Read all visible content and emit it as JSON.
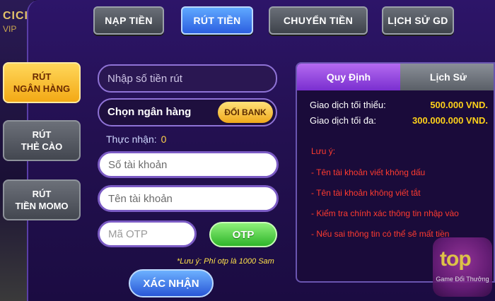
{
  "background": {
    "brand_text": "CICI",
    "brand_sub": "VIP"
  },
  "top_tabs": [
    {
      "label": "NẠP TIỀN",
      "active": false
    },
    {
      "label": "RÚT TIỀN",
      "active": true
    },
    {
      "label": "CHUYỂN TIỀN",
      "active": false
    },
    {
      "label": "LỊCH SỬ GD",
      "active": false
    }
  ],
  "side_tabs": [
    {
      "line1": "RÚT",
      "line2": "NGÂN HÀNG",
      "active": true
    },
    {
      "line1": "RÚT",
      "line2": "THẺ CÀO",
      "active": false
    },
    {
      "line1": "RÚT",
      "line2": "TIỀN MOMO",
      "active": false
    }
  ],
  "form": {
    "amount_placeholder": "Nhập số tiền rút",
    "bank_label": "Chọn ngân hàng",
    "bank_button": "ĐỔI BANK",
    "received_label": "Thực nhận:",
    "received_value": "0",
    "account_number_placeholder": "Số tài khoản",
    "account_name_placeholder": "Tên tài khoản",
    "otp_placeholder": "Mã OTP",
    "otp_button": "OTP",
    "otp_note": "*Lưu ý: Phí otp là 1000 Sam",
    "confirm_button": "XÁC NHẬN"
  },
  "rules": {
    "tabs": [
      {
        "label": "Quy Định",
        "active": true
      },
      {
        "label": "Lịch Sử",
        "active": false
      }
    ],
    "min_label": "Giao dịch tối thiểu:",
    "min_value": "500.000 VND.",
    "max_label": "Giao dịch tối đa:",
    "max_value": "300.000.000 VND.",
    "notes_title": "Lưu ý:",
    "notes": [
      "- Tên tài khoản viết không dấu",
      "- Tên tài khoản không viết tắt",
      "- Kiểm tra chính xác thông tin nhập vào",
      "- Nếu sai thông tin có thể sẽ mất tiền"
    ]
  },
  "watermark": {
    "logo": "top",
    "caption": "Game Đổi Thưởng"
  },
  "colors": {
    "accent_blue": "#2c5fe0",
    "accent_yellow": "#f3a915",
    "warning_red": "#ff3b2f",
    "value_yellow": "#ffd21a"
  }
}
